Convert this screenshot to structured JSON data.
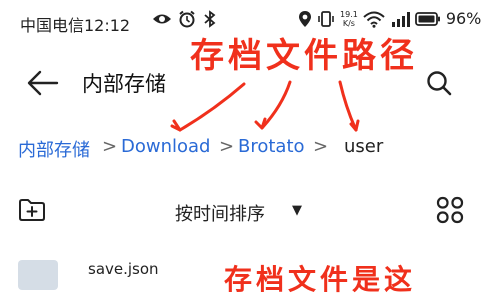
{
  "status_bar": {
    "carrier_time": "中国电信12:12",
    "speed_value": "19.1",
    "speed_unit": "K/s",
    "battery_percent": "96%"
  },
  "header": {
    "title": "内部存储",
    "back_icon": "arrow-left-icon",
    "search_icon": "search-icon"
  },
  "annotations": {
    "top": "存档文件路径",
    "bottom": "存档文件是这",
    "color": "#f0301c"
  },
  "breadcrumb": {
    "items": [
      "内部存储",
      "Download",
      "Brotato",
      "user"
    ],
    "separator": ">",
    "link_color": "#2a6ad6"
  },
  "toolbar": {
    "sort_label": "按时间排序",
    "sort_caret": "▼",
    "new_folder_icon": "new-folder-icon",
    "view_toggle_icon": "grid-view-icon"
  },
  "files": [
    {
      "name": "save.json",
      "icon": "file-icon"
    }
  ]
}
